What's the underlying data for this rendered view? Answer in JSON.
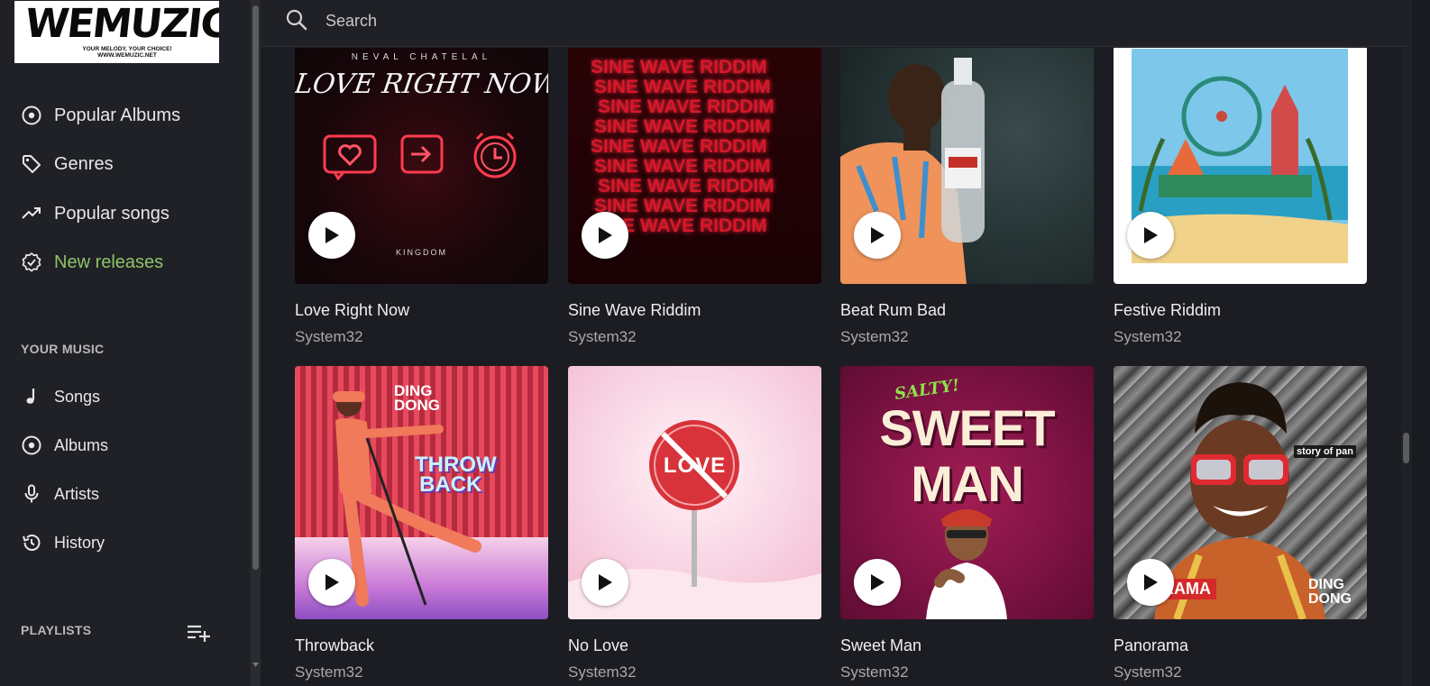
{
  "logo": {
    "title": "WEMUZIC",
    "tagline": "YOUR MELODY, YOUR CHOICE!",
    "url": "WWW.WEMUZIC.NET"
  },
  "nav": {
    "items": [
      {
        "label": "Popular Albums",
        "icon": "album-icon"
      },
      {
        "label": "Genres",
        "icon": "tag-icon"
      },
      {
        "label": "Popular songs",
        "icon": "trending-icon"
      },
      {
        "label": "New releases",
        "icon": "badge-check-icon",
        "active": true
      }
    ]
  },
  "your_music": {
    "title": "YOUR MUSIC",
    "items": [
      {
        "label": "Songs",
        "icon": "music-note-icon"
      },
      {
        "label": "Albums",
        "icon": "album-icon"
      },
      {
        "label": "Artists",
        "icon": "microphone-icon"
      },
      {
        "label": "History",
        "icon": "history-icon"
      }
    ]
  },
  "playlists": {
    "title": "PLAYLISTS",
    "add_icon": "playlist-add-icon"
  },
  "search": {
    "placeholder": "Search"
  },
  "colors": {
    "accent": "#8fc466",
    "background": "#1c1d22",
    "sidebar": "#1f2126"
  },
  "albums": [
    {
      "title": "Love Right Now",
      "artist": "System32",
      "cover_text": {
        "artist": "NEVAL CHATELAL",
        "title": "LOVE RIGHT NOW",
        "label": "KINGDOM"
      }
    },
    {
      "title": "Sine Wave Riddim",
      "artist": "System32",
      "cover_text": {
        "line": "SINE WAVE RIDDIM"
      }
    },
    {
      "title": "Beat Rum Bad",
      "artist": "System32",
      "cover_text": {}
    },
    {
      "title": "Festive Riddim",
      "artist": "System32",
      "cover_text": {}
    },
    {
      "title": "Throwback",
      "artist": "System32",
      "cover_text": {
        "top1": "DING",
        "top2": "DONG",
        "main1": "THROW",
        "main2": "BACK"
      }
    },
    {
      "title": "No Love",
      "artist": "System32",
      "cover_text": {
        "sign": "LOVE"
      }
    },
    {
      "title": "Sweet Man",
      "artist": "System32",
      "cover_text": {
        "top": "SALTY!",
        "main1": "SWEET",
        "main2": "MAN"
      }
    },
    {
      "title": "Panorama",
      "artist": "System32",
      "cover_text": {
        "side": "story of pan",
        "banner": "RAMA",
        "brand1": "DING",
        "brand2": "DONG"
      }
    }
  ]
}
